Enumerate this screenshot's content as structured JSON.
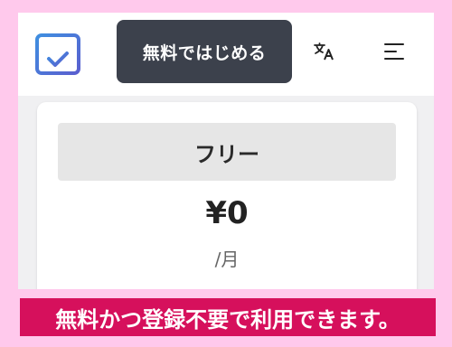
{
  "header": {
    "cta_label": "無料ではじめる",
    "icons": [
      "calendar-check-icon",
      "translate-icon",
      "menu-icon"
    ]
  },
  "plan": {
    "name": "フリー",
    "price": "¥0",
    "period": "/月"
  },
  "caption": "無料かつ登録不要で利用できます。",
  "colors": {
    "background": "#ffc9ec",
    "cta_bg": "#3c414c",
    "calendar_accent": "#4a7bd6",
    "caption_bg": "#d6105c"
  }
}
